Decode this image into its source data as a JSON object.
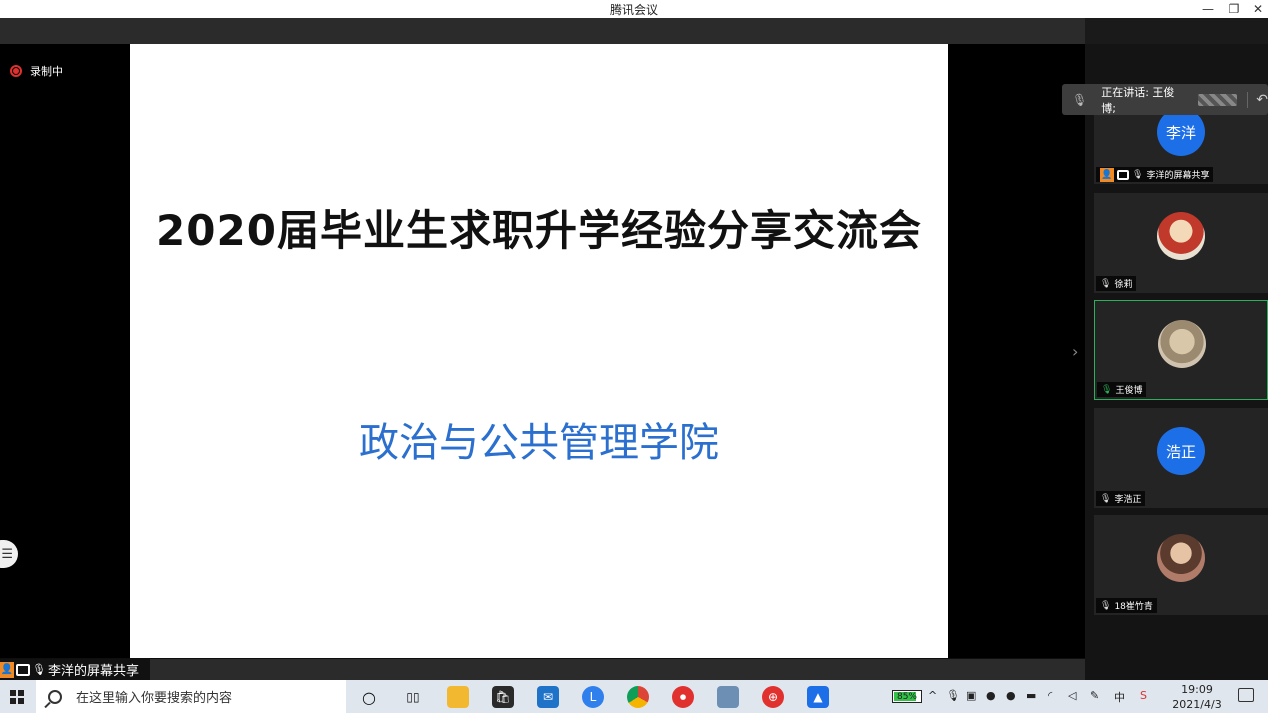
{
  "window": {
    "title": "腾讯会议"
  },
  "recording": {
    "label": "录制中"
  },
  "slide": {
    "title": "2020届毕业生求职升学经验分享交流会",
    "subtitle": "政治与公共管理学院"
  },
  "share_bar": {
    "label": "李洋的屏幕共享"
  },
  "speaking": {
    "label": "正在讲话: 王俊博;"
  },
  "participants": [
    {
      "name": "李洋的屏幕共享",
      "avatar_text": "李洋",
      "avatar": "blue"
    },
    {
      "name": "徐莉",
      "avatar_text": "",
      "avatar": "photo"
    },
    {
      "name": "王俊博",
      "avatar_text": "",
      "avatar": "photo",
      "active": true
    },
    {
      "name": "李浩正",
      "avatar_text": "浩正",
      "avatar": "blue"
    },
    {
      "name": "18崔竹青",
      "avatar_text": "",
      "avatar": "photo"
    }
  ],
  "taskbar": {
    "search_placeholder": "在这里输入你要搜索的内容",
    "battery": "85%",
    "ime": "中",
    "time": "19:09",
    "date": "2021/4/3"
  },
  "colors": {
    "accent_blue": "#1d6fe8",
    "record_red": "#e0312f",
    "active_green": "#2fae5b",
    "subtitle_blue": "#2b6fcf"
  },
  "icons": [
    "record-icon",
    "minimize-icon",
    "restore-icon",
    "close-icon",
    "mic-icon",
    "screen-share-icon",
    "user-icon",
    "windows-start-icon",
    "search-icon"
  ]
}
